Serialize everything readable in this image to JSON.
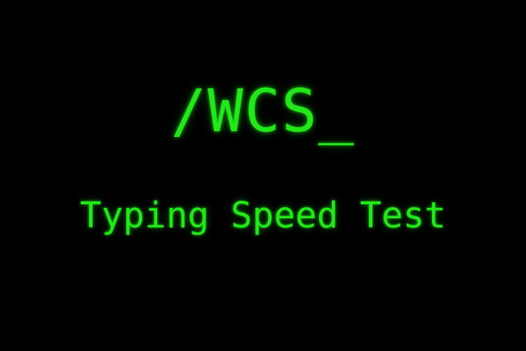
{
  "logo": {
    "text": "/WCS_"
  },
  "subtitle": {
    "text": "Typing Speed Test"
  },
  "theme": {
    "background": "#000000",
    "accent": "#22e81a"
  }
}
